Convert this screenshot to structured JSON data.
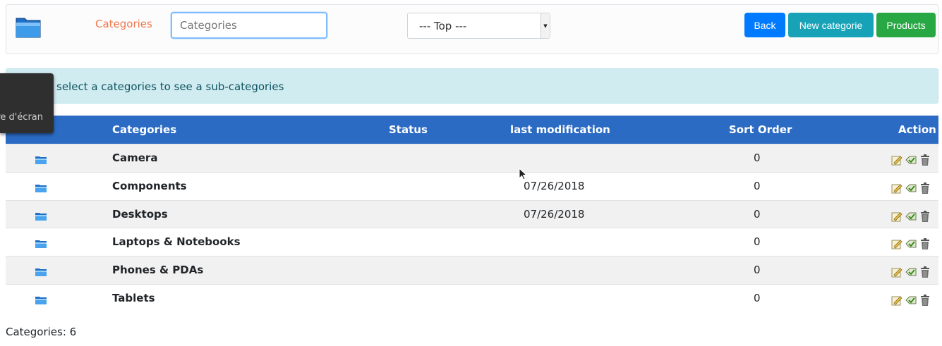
{
  "header": {
    "title": "Categories",
    "search_placeholder": "Categories",
    "search_value": "",
    "parent_select": "--- Top ---",
    "back_label": "Back",
    "new_label": "New categorie",
    "products_label": "Products"
  },
  "info_message": "select a categories to see a sub-categories",
  "tooltip_text": "re d'écran",
  "table": {
    "columns": [
      "Categories",
      "Status",
      "last modification",
      "Sort Order",
      "Action"
    ],
    "rows": [
      {
        "name": "Camera",
        "status": "",
        "modified": "",
        "sort": "0"
      },
      {
        "name": "Components",
        "status": "",
        "modified": "07/26/2018",
        "sort": "0"
      },
      {
        "name": "Desktops",
        "status": "",
        "modified": "07/26/2018",
        "sort": "0"
      },
      {
        "name": "Laptops & Notebooks",
        "status": "",
        "modified": "",
        "sort": "0"
      },
      {
        "name": "Phones & PDAs",
        "status": "",
        "modified": "",
        "sort": "0"
      },
      {
        "name": "Tablets",
        "status": "",
        "modified": "",
        "sort": "0"
      }
    ]
  },
  "footer": "Categories: 6",
  "colors": {
    "header_blue": "#2b6bc4",
    "title_orange": "#f0784d",
    "info_bg": "#d1ecf1"
  },
  "icons": [
    "folder-icon",
    "edit-icon",
    "move-icon",
    "trash-icon",
    "cursor-icon"
  ]
}
